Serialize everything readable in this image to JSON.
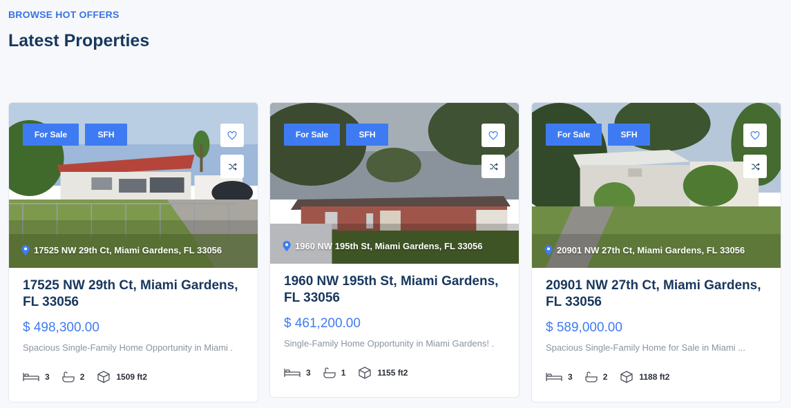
{
  "section": {
    "eyebrow": "BROWSE HOT OFFERS",
    "title": "Latest Properties"
  },
  "colors": {
    "accent": "#3e7bf2",
    "heading": "#17375e",
    "muted": "#8a93a0"
  },
  "properties": [
    {
      "status": "For Sale",
      "type": "SFH",
      "address": "17525 NW 29th Ct, Miami Gardens, FL 33056",
      "title": "17525 NW 29th Ct, Miami Gardens, FL 33056",
      "price": "$ 498,300.00",
      "description": "Spacious Single-Family Home Opportunity in Miami ...",
      "beds": "3",
      "baths": "2",
      "area": "1509 ft2"
    },
    {
      "status": "For Sale",
      "type": "SFH",
      "address": "1960 NW 195th St, Miami Gardens, FL 33056",
      "title": "1960 NW 195th St, Miami Gardens, FL 33056",
      "price": "$ 461,200.00",
      "description": "Single-Family Home Opportunity in Miami Gardens! ...",
      "beds": "3",
      "baths": "1",
      "area": "1155 ft2"
    },
    {
      "status": "For Sale",
      "type": "SFH",
      "address": "20901 NW 27th Ct, Miami Gardens, FL 33056",
      "title": "20901 NW 27th Ct, Miami Gardens, FL 33056",
      "price": "$ 589,000.00",
      "description": "Spacious Single-Family Home for Sale in Miami ...",
      "beds": "3",
      "baths": "2",
      "area": "1188 ft2"
    }
  ],
  "icons": {
    "favorite": "heart-icon",
    "compare": "shuffle-icon",
    "location": "map-pin-icon",
    "beds": "bed-icon",
    "baths": "bathtub-icon",
    "area": "cube-icon"
  }
}
